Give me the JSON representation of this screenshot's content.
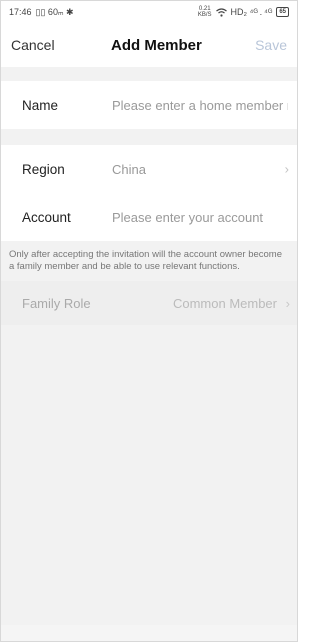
{
  "status_bar": {
    "time": "17:46",
    "left_icons": "▯▯ 60ₘ ✱",
    "net_speed_top": "0.21",
    "net_speed_bottom": "KB/S",
    "right_icons": "HD₂ ⁴ᴳ . ⁴ᴳ",
    "battery": "65"
  },
  "header": {
    "cancel_label": "Cancel",
    "title": "Add Member",
    "save_label": "Save"
  },
  "form": {
    "name_label": "Name",
    "name_placeholder": "Please enter a home member name",
    "region_label": "Region",
    "region_value": "China",
    "account_label": "Account",
    "account_placeholder": "Please enter your account",
    "note": "Only after accepting the invitation will the account owner become a family member and be able to use relevant functions.",
    "role_label": "Family Role",
    "role_value": "Common Member"
  },
  "icons": {
    "chevron": "chevron-right-icon",
    "bluetooth": "bluetooth-icon",
    "wifi": "wifi-icon",
    "signal": "signal-icon",
    "battery": "battery-icon"
  },
  "colors": {
    "save_disabled": "#b9c6d9",
    "background": "#f2f2f2"
  }
}
